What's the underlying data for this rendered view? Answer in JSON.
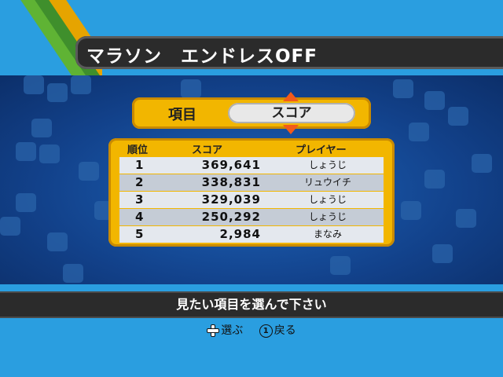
{
  "title": "マラソン　エンドレスOFF",
  "selector": {
    "label": "項目",
    "value": "スコア"
  },
  "table": {
    "headers": {
      "rank": "順位",
      "score": "スコア",
      "player": "プレイヤー"
    },
    "rows": [
      {
        "rank": "1",
        "score": "369,641",
        "player": "しょうじ"
      },
      {
        "rank": "2",
        "score": "338,831",
        "player": "リュウイチ"
      },
      {
        "rank": "3",
        "score": "329,039",
        "player": "しょうじ"
      },
      {
        "rank": "4",
        "score": "250,292",
        "player": "しょうじ"
      },
      {
        "rank": "5",
        "score": "2,984",
        "player": "まなみ"
      }
    ]
  },
  "message": "見たい項目を選んで下さい",
  "controls": {
    "select_label": "選ぶ",
    "back_button": "1",
    "back_label": "戻る"
  },
  "colors": {
    "accent": "#f2b600",
    "arrow": "#f25a1a",
    "bar": "#2b2b2b"
  }
}
